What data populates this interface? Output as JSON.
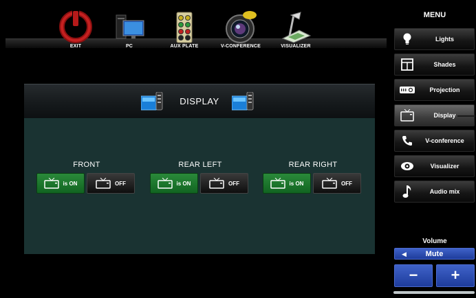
{
  "sources": [
    {
      "name": "source-exit",
      "label": "EXIT",
      "icon": "power-icon"
    },
    {
      "name": "source-pc",
      "label": "PC",
      "icon": "computer-icon"
    },
    {
      "name": "source-aux-plate",
      "label": "AUX PLATE",
      "icon": "aux-plate-icon"
    },
    {
      "name": "source-v-conference",
      "label": "V-CONFERENCE",
      "icon": "camera-icon"
    },
    {
      "name": "source-visualizer",
      "label": "VISUALIZER",
      "icon": "document-camera-icon"
    }
  ],
  "panel": {
    "title": "DISPLAY",
    "zones": [
      {
        "name": "FRONT",
        "on_label": "is ON",
        "off_label": "OFF",
        "state": "on"
      },
      {
        "name": "REAR LEFT",
        "on_label": "is ON",
        "off_label": "OFF",
        "state": "on"
      },
      {
        "name": "REAR RIGHT",
        "on_label": "is ON",
        "off_label": "OFF",
        "state": "on"
      }
    ]
  },
  "menu": {
    "title": "MENU",
    "items": [
      {
        "label": "Lights",
        "icon": "bulb-icon"
      },
      {
        "label": "Shades",
        "icon": "window-icon"
      },
      {
        "label": "Projection",
        "icon": "projector-icon"
      },
      {
        "label": "Display",
        "icon": "tv-icon",
        "active": true
      },
      {
        "label": "V-conference",
        "icon": "phone-icon"
      },
      {
        "label": "Visualizer",
        "icon": "eye-icon"
      },
      {
        "label": "Audio mix",
        "icon": "music-note-icon"
      }
    ]
  },
  "volume": {
    "title": "Volume",
    "mute_label": "Mute",
    "minus_label": "−",
    "plus_label": "+"
  },
  "colors": {
    "accent_blue": "#2d4fb8",
    "on_green": "#1d7a2e",
    "panel_teal": "#1a3332"
  }
}
